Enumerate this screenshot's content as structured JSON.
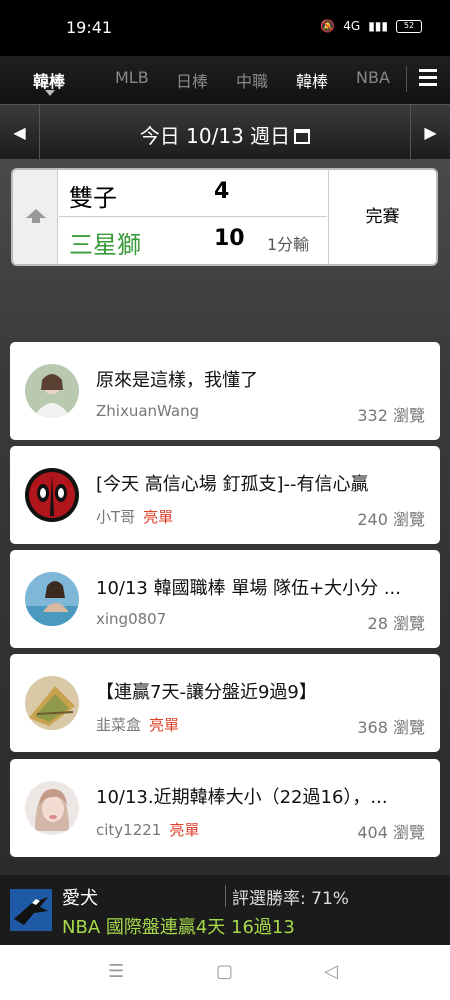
{
  "status_bar": {
    "time": "19:41",
    "network": "4G",
    "battery": "52"
  },
  "nav": {
    "current": "韓棒",
    "tabs": [
      "MLB",
      "日棒",
      "中職",
      "韓棒",
      "NBA"
    ],
    "active_index": 3
  },
  "date_bar": {
    "label": "今日 10/13 週日"
  },
  "game": {
    "team1": {
      "name": "雙子",
      "score": "4",
      "note": ""
    },
    "team2": {
      "name": "三星獅",
      "score": "10",
      "note": "1分輸"
    },
    "status": "完賽"
  },
  "posts": [
    {
      "title": "原來是這樣，我懂了",
      "author": "ZhixuanWang",
      "badge": "",
      "views": "332 瀏覽"
    },
    {
      "title": "[今天 高信心場 釘孤支]--有信心贏",
      "author": "小T哥",
      "badge": "亮單",
      "views": "240 瀏覽"
    },
    {
      "title": "10/13 韓國職棒 單場 隊伍+大小分 ...",
      "author": "xing0807",
      "badge": "",
      "views": "28 瀏覽"
    },
    {
      "title": "【連贏7天-讓分盤近9過9】",
      "author": "韭菜盒",
      "badge": "亮單",
      "views": "368 瀏覽"
    },
    {
      "title": "10/13.近期韓棒大小（22過16），...",
      "author": "city1221",
      "badge": "亮單",
      "views": "404 瀏覽"
    }
  ],
  "footer": {
    "name": "愛犬",
    "win_rate": "評選勝率: 71%",
    "promo": "NBA 國際盤連贏4天 16過13"
  },
  "colors": {
    "badge": "#e0412b",
    "promo": "#a6d94a",
    "home_team": "#3a9a3a"
  }
}
